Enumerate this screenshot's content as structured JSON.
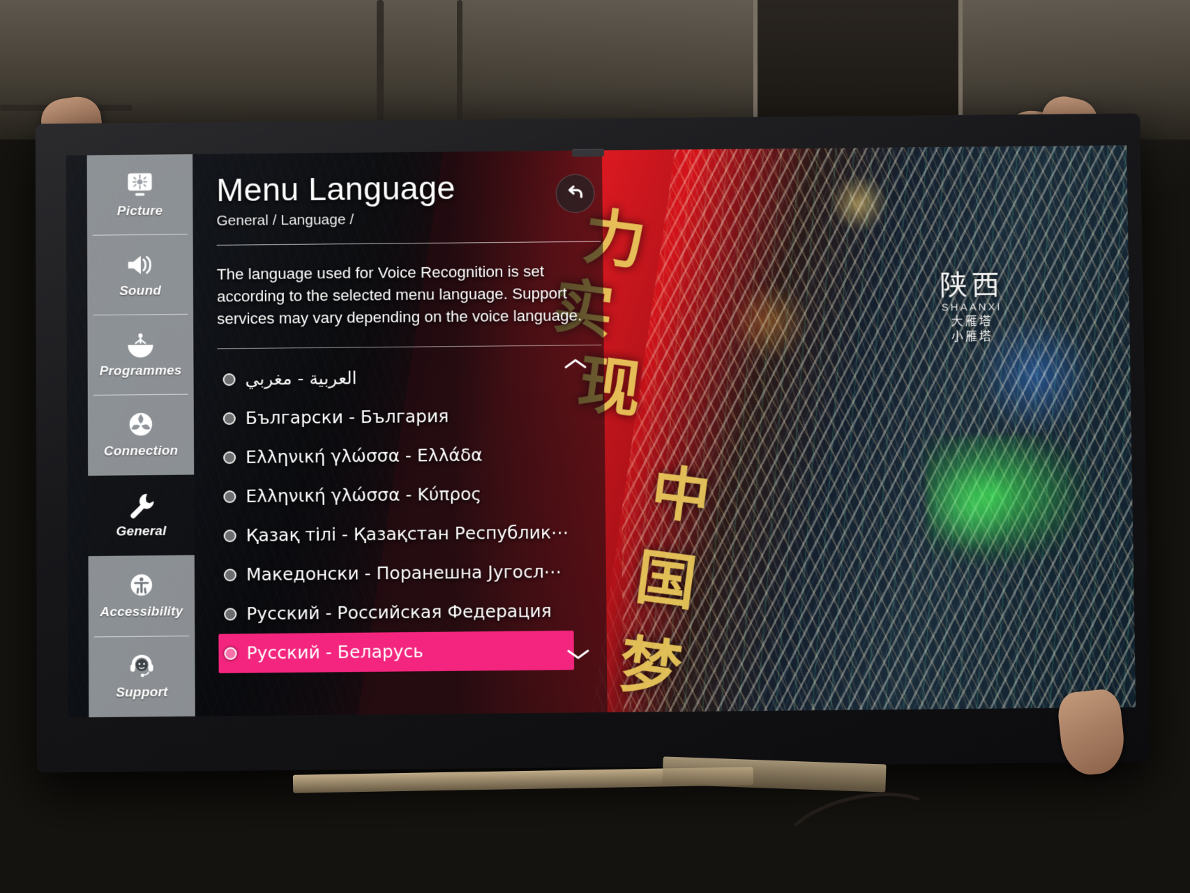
{
  "sidebar": {
    "items": [
      {
        "label": "Picture",
        "icon": "picture-icon",
        "selected": false
      },
      {
        "label": "Sound",
        "icon": "speaker-icon",
        "selected": false
      },
      {
        "label": "Programmes",
        "icon": "satellite-dish-icon",
        "selected": false
      },
      {
        "label": "Connection",
        "icon": "network-globe-icon",
        "selected": false
      },
      {
        "label": "General",
        "icon": "wrench-icon",
        "selected": true
      },
      {
        "label": "Accessibility",
        "icon": "accessibility-icon",
        "selected": false
      },
      {
        "label": "Support",
        "icon": "headset-icon",
        "selected": false
      }
    ]
  },
  "header": {
    "title": "Menu Language",
    "breadcrumb": "General / Language /",
    "back_icon": "back-arrow-icon"
  },
  "description": "The language used for Voice Recognition is set according to the selected menu language. Support services may vary depending on the voice language.",
  "languages": {
    "scroll_up_icon": "chevron-up-icon",
    "scroll_down_icon": "chevron-down-icon",
    "items": [
      {
        "label": "العربية - مغربي",
        "rtl": true,
        "selected": false
      },
      {
        "label": "Български - България",
        "rtl": false,
        "selected": false
      },
      {
        "label": "Ελληνική γλώσσα - Ελλάδα",
        "rtl": false,
        "selected": false
      },
      {
        "label": "Ελληνική γλώσσα - Κύπρος",
        "rtl": false,
        "selected": false
      },
      {
        "label": "Қазақ тілі - Қазақстан Республик⋯",
        "rtl": false,
        "selected": false
      },
      {
        "label": "Македонски - Поранешна Југосл⋯",
        "rtl": false,
        "selected": false
      },
      {
        "label": "Русский - Российская Федерация",
        "rtl": false,
        "selected": false
      },
      {
        "label": "Русский - Беларусь",
        "rtl": false,
        "selected": true
      }
    ]
  },
  "video_overlay": {
    "region_cn": "陕西",
    "region_romanized": "SHAANXI",
    "landmark_cn": "大雁塔",
    "landmark_small_cn": "小雁塔",
    "banner_chars": [
      "力",
      "实",
      "现",
      "中",
      "国",
      "梦"
    ]
  },
  "colors": {
    "selection_pink": "#f4257e",
    "sidebar_grey": "#abb0b4",
    "text_white": "#ffffff",
    "banner_red": "#e21a22",
    "accent_gold": "#e8c65a"
  }
}
